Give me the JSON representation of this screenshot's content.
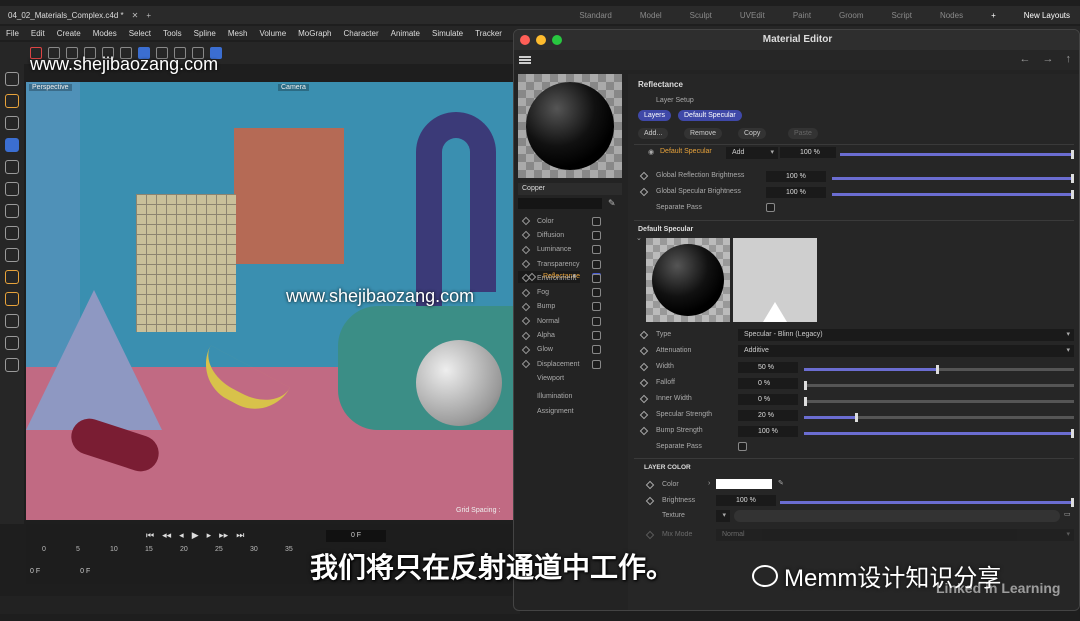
{
  "titlebar": {
    "file_tab": "04_02_Materials_Complex.c4d *",
    "workspaces": [
      "Standard",
      "Model",
      "Sculpt",
      "UVEdit",
      "Paint",
      "Groom",
      "Script",
      "Nodes"
    ],
    "new_layouts": "New Layouts"
  },
  "menu": [
    "File",
    "Edit",
    "Create",
    "Modes",
    "Select",
    "Tools",
    "Spline",
    "Mesh",
    "Volume",
    "MoGraph",
    "Character",
    "Animate",
    "Simulate",
    "Tracker"
  ],
  "viewport": {
    "label": "Perspective",
    "camera": "Camera",
    "grid_spacing": "Grid Spacing :"
  },
  "timeline": {
    "current_frame": "0 F",
    "ticks": [
      "0",
      "5",
      "10",
      "15",
      "20",
      "25",
      "30",
      "35"
    ],
    "start_frame": "0 F",
    "min_frame": "0 F"
  },
  "material_editor": {
    "title": "Material Editor",
    "material_name": "Copper",
    "channels": [
      {
        "label": "Color",
        "checked": false
      },
      {
        "label": "Diffusion",
        "checked": false
      },
      {
        "label": "Luminance",
        "checked": false
      },
      {
        "label": "Transparency",
        "checked": false
      },
      {
        "label": "Reflectance",
        "checked": true
      },
      {
        "label": "Environment",
        "checked": false
      },
      {
        "label": "Fog",
        "checked": false
      },
      {
        "label": "Bump",
        "checked": false
      },
      {
        "label": "Normal",
        "checked": false
      },
      {
        "label": "Alpha",
        "checked": false
      },
      {
        "label": "Glow",
        "checked": false
      },
      {
        "label": "Displacement",
        "checked": false
      }
    ],
    "extra_items": [
      "Viewport",
      "Illumination",
      "Assignment"
    ],
    "reflectance": {
      "title": "Reflectance",
      "layer_setup": "Layer Setup",
      "tab_layers": "Layers",
      "tab_default_specular": "Default Specular",
      "btn_add": "Add...",
      "btn_remove": "Remove",
      "btn_copy": "Copy",
      "btn_paste": "Paste",
      "layer_name": "Default Specular",
      "layer_mode": "Add",
      "layer_value": "100 %",
      "layer_fraction": 1.0,
      "global_reflection_label": "Global Reflection Brightness",
      "global_reflection_value": "100 %",
      "global_reflection_fraction": 1.0,
      "global_specular_label": "Global Specular Brightness",
      "global_specular_value": "100 %",
      "global_specular_fraction": 1.0,
      "separate_pass": "Separate Pass"
    },
    "default_specular": {
      "title": "Default Specular",
      "type_label": "Type",
      "type_value": "Specular - Blinn (Legacy)",
      "attenuation_label": "Attenuation",
      "attenuation_value": "Additive",
      "width_label": "Width",
      "width_value": "50 %",
      "width_fraction": 0.5,
      "falloff_label": "Falloff",
      "falloff_value": "0 %",
      "falloff_fraction": 0.0,
      "inner_width_label": "Inner Width",
      "inner_width_value": "0 %",
      "inner_width_fraction": 0.0,
      "specular_strength_label": "Specular Strength",
      "specular_strength_value": "20 %",
      "specular_strength_fraction": 0.2,
      "bump_strength_label": "Bump Strength",
      "bump_strength_value": "100 %",
      "bump_strength_fraction": 1.0,
      "separate_pass": "Separate Pass"
    },
    "layer_color": {
      "title": "LAYER COLOR",
      "color_label": "Color",
      "color_value": "#ffffff",
      "brightness_label": "Brightness",
      "brightness_value": "100 %",
      "brightness_fraction": 1.0,
      "texture_label": "Texture",
      "mix_mode_label": "Mix Mode",
      "mix_mode_value": "Normal"
    }
  },
  "overlays": {
    "watermark": "www.shejibaozang.com",
    "subtitle": "我们将只在反射通道中工作。",
    "wechat": "Memm设计知识分享",
    "linkedin": "Linked in Learning"
  }
}
